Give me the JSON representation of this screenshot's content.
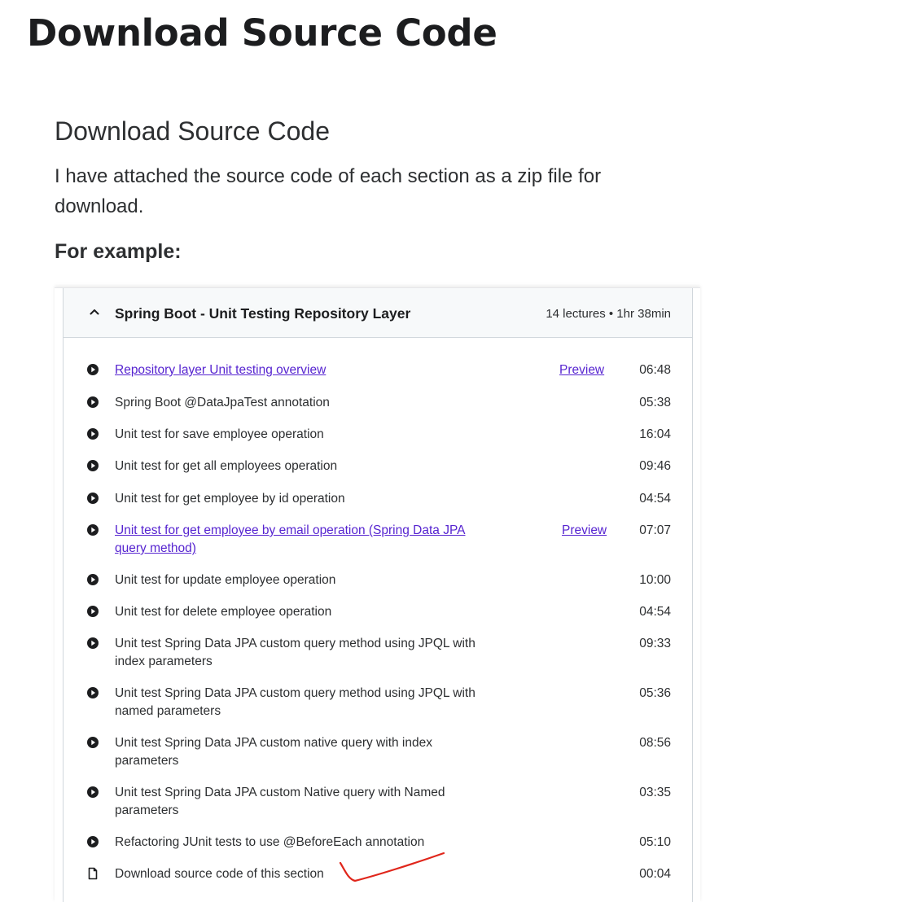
{
  "page": {
    "title": "Download Source Code",
    "heading": "Download Source Code",
    "description": "I have attached the source code of each section as a zip file for download.",
    "example_label": "For example:"
  },
  "section": {
    "title": "Spring Boot - Unit Testing Repository Layer",
    "meta": "14 lectures • 1hr 38min",
    "expanded": true
  },
  "colors": {
    "link": "#5624d0",
    "header_bg": "#f7f9fa",
    "annotation": "#e0261b"
  },
  "lectures": [
    {
      "title": "Repository layer Unit testing overview",
      "duration": "06:48",
      "preview": "Preview",
      "link": true,
      "icon": "play-circle-icon"
    },
    {
      "title": "Spring Boot @DataJpaTest annotation",
      "duration": "05:38",
      "icon": "play-circle-icon"
    },
    {
      "title": "Unit test for save employee operation",
      "duration": "16:04",
      "icon": "play-circle-icon"
    },
    {
      "title": "Unit test for get all employees operation",
      "duration": "09:46",
      "icon": "play-circle-icon"
    },
    {
      "title": "Unit test for get employee by id operation",
      "duration": "04:54",
      "icon": "play-circle-icon"
    },
    {
      "title": "Unit test for get employee by email operation (Spring Data JPA query method)",
      "duration": "07:07",
      "preview": "Preview",
      "link": true,
      "icon": "play-circle-icon"
    },
    {
      "title": "Unit test for update employee operation",
      "duration": "10:00",
      "icon": "play-circle-icon"
    },
    {
      "title": "Unit test for delete employee operation",
      "duration": "04:54",
      "icon": "play-circle-icon"
    },
    {
      "title": "Unit test Spring Data JPA custom query method using JPQL with index parameters",
      "duration": "09:33",
      "icon": "play-circle-icon"
    },
    {
      "title": "Unit test Spring Data JPA custom query method using JPQL with named parameters",
      "duration": "05:36",
      "icon": "play-circle-icon"
    },
    {
      "title": "Unit test Spring Data JPA custom native query with index parameters",
      "duration": "08:56",
      "icon": "play-circle-icon"
    },
    {
      "title": "Unit test Spring Data JPA custom Native query with Named parameters",
      "duration": "03:35",
      "icon": "play-circle-icon"
    },
    {
      "title": "Refactoring JUnit tests to use @BeforeEach annotation",
      "duration": "05:10",
      "icon": "play-circle-icon"
    },
    {
      "title": "Download source code of this section",
      "duration": "00:04",
      "icon": "file-icon"
    }
  ]
}
